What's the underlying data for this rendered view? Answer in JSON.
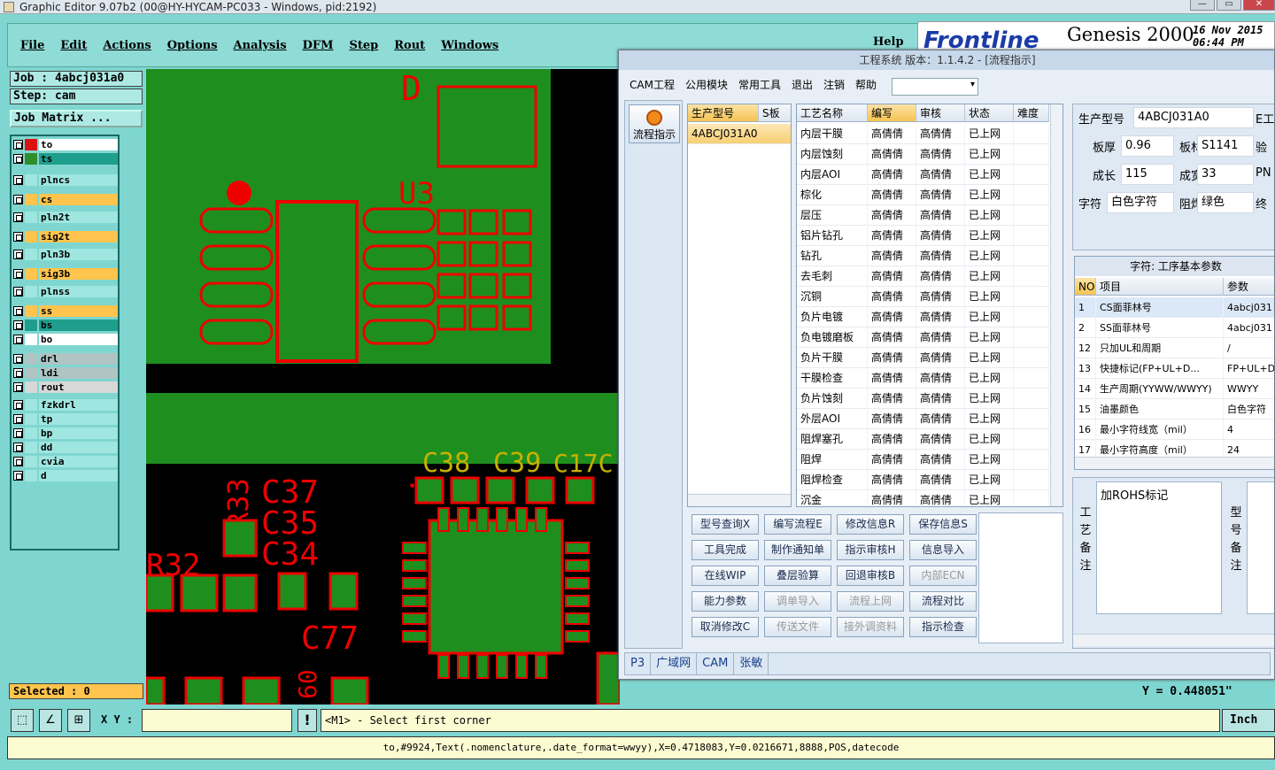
{
  "window": {
    "title": "Graphic Editor 9.07b2 (00@HY-HYCAM-PC033 - Windows, pid:2192)"
  },
  "menu": {
    "items": [
      "File",
      "Edit",
      "Actions",
      "Options",
      "Analysis",
      "DFM",
      "Step",
      "Rout",
      "Windows"
    ],
    "help": "Help"
  },
  "brand": {
    "logo": "Frontline",
    "product": "Genesis 2000",
    "date": "16 Nov 2015",
    "time": "06:44 PM"
  },
  "job": {
    "job_label": "Job : 4abcj031a0",
    "step_label": "Step: cam",
    "matrix_button": "Job Matrix ..."
  },
  "layers": [
    {
      "name": "to",
      "bg": "#ffffff",
      "swatch": "#d11"
    },
    {
      "name": "ts",
      "bg": "#1f9e8e",
      "swatch": "#2f8f2f"
    },
    {
      "name": "plncs",
      "bg": "#9fe6e0",
      "swatch": ""
    },
    {
      "name": "cs",
      "bg": "#ffc44d",
      "swatch": ""
    },
    {
      "name": "pln2t",
      "bg": "#9fe6e0",
      "swatch": ""
    },
    {
      "name": "sig2t",
      "bg": "#ffc44d",
      "swatch": ""
    },
    {
      "name": "pln3b",
      "bg": "#9fe6e0",
      "swatch": ""
    },
    {
      "name": "sig3b",
      "bg": "#ffc44d",
      "swatch": ""
    },
    {
      "name": "plnss",
      "bg": "#9fe6e0",
      "swatch": ""
    },
    {
      "name": "ss",
      "bg": "#ffc44d",
      "swatch": ""
    },
    {
      "name": "bs",
      "bg": "#1f9e8e",
      "swatch": ""
    },
    {
      "name": "bo",
      "bg": "#ffffff",
      "swatch": ""
    },
    {
      "name": "drl",
      "bg": "#b0c4c4",
      "swatch": ""
    },
    {
      "name": "ldi",
      "bg": "#b0c4c4",
      "swatch": ""
    },
    {
      "name": "rout",
      "bg": "#d8d8d8",
      "swatch": ""
    },
    {
      "name": "fzkdrl",
      "bg": "#9fe6e0",
      "swatch": ""
    },
    {
      "name": "tp",
      "bg": "#9fe6e0",
      "swatch": ""
    },
    {
      "name": "bp",
      "bg": "#9fe6e0",
      "swatch": ""
    },
    {
      "name": "dd",
      "bg": "#9fe6e0",
      "swatch": ""
    },
    {
      "name": "cvia",
      "bg": "#9fe6e0",
      "swatch": ""
    },
    {
      "name": "d",
      "bg": "#9fe6e0",
      "swatch": ""
    }
  ],
  "selected": "Selected : 0",
  "canvas_labels": {
    "u3": "U3",
    "d": "D",
    "c38": "C38",
    "c39": "C39",
    "c17": "C17C",
    "r33": "R33",
    "c37": "C37",
    "c35": "C35",
    "c34": "C34",
    "r32": "R32",
    "c77": "C77",
    "n60": "60"
  },
  "xy": {
    "label": "X Y :",
    "value": ""
  },
  "prompt": "<M1> - Select first corner",
  "units": "Inch",
  "y_readout": "Y = 0.448051\"",
  "status": "to,#9924,Text(.nomenclature,.date_format=wwyy),X=0.4718083,Y=0.0216671,8888,POS,datecode",
  "cam": {
    "title": "工程系统  版本：1.1.4.2 - [流程指示]",
    "menu": [
      "CAM工程",
      "公用模块",
      "常用工具",
      "退出",
      "注销",
      "帮助"
    ],
    "flow_button": "流程指示",
    "model_headers": [
      "生产型号",
      "S板"
    ],
    "model_row": "4ABCJ031A0",
    "proc_headers": [
      "工艺名称",
      "编写",
      "审核",
      "状态",
      "难度"
    ],
    "proc_rows": [
      [
        "内层干膜",
        "高倩倩",
        "高倩倩",
        "已上网"
      ],
      [
        "内层蚀刻",
        "高倩倩",
        "高倩倩",
        "已上网"
      ],
      [
        "内层AOI",
        "高倩倩",
        "高倩倩",
        "已上网"
      ],
      [
        "棕化",
        "高倩倩",
        "高倩倩",
        "已上网"
      ],
      [
        "层压",
        "高倩倩",
        "高倩倩",
        "已上网"
      ],
      [
        "铝片钻孔",
        "高倩倩",
        "高倩倩",
        "已上网"
      ],
      [
        "钻孔",
        "高倩倩",
        "高倩倩",
        "已上网"
      ],
      [
        "去毛刺",
        "高倩倩",
        "高倩倩",
        "已上网"
      ],
      [
        "沉铜",
        "高倩倩",
        "高倩倩",
        "已上网"
      ],
      [
        "负片电镀",
        "高倩倩",
        "高倩倩",
        "已上网"
      ],
      [
        "负电镀磨板",
        "高倩倩",
        "高倩倩",
        "已上网"
      ],
      [
        "负片干膜",
        "高倩倩",
        "高倩倩",
        "已上网"
      ],
      [
        "干膜检查",
        "高倩倩",
        "高倩倩",
        "已上网"
      ],
      [
        "负片蚀刻",
        "高倩倩",
        "高倩倩",
        "已上网"
      ],
      [
        "外层AOI",
        "高倩倩",
        "高倩倩",
        "已上网"
      ],
      [
        "阻焊塞孔",
        "高倩倩",
        "高倩倩",
        "已上网"
      ],
      [
        "阻焊",
        "高倩倩",
        "高倩倩",
        "已上网"
      ],
      [
        "阻焊检查",
        "高倩倩",
        "高倩倩",
        "已上网"
      ],
      [
        "沉金",
        "高倩倩",
        "高倩倩",
        "已上网"
      ]
    ],
    "buttons": [
      [
        "型号查询X",
        "编写流程E",
        "修改信息R",
        "保存信息S"
      ],
      [
        "工具完成",
        "制作通知单",
        "指示审核H",
        "信息导入"
      ],
      [
        "在线WIP",
        "叠层验算",
        "回退审核B",
        "内部ECN"
      ],
      [
        "能力参数",
        "调单导入",
        "流程上网",
        "流程对比"
      ],
      [
        "取消修改C",
        "传送文件",
        "接外调资料",
        "指示检查"
      ]
    ],
    "info": {
      "model_label": "生产型号",
      "model_value": "4ABCJ031A0",
      "extra": "E工",
      "thick_label": "板厚",
      "thick_value": "0.96",
      "mat_label": "板材",
      "mat_value": "S1141",
      "extra2": "验",
      "len_label": "成长",
      "len_value": "115",
      "wid_label": "成宽",
      "wid_value": "33",
      "extra3": "PN",
      "char_label": "字符",
      "char_value": "白色字符",
      "mask_label": "阻焊",
      "mask_value": "绿色",
      "extra4": "终"
    },
    "param_title": "字符: 工序基本参数",
    "param_headers": [
      "NO",
      "项目",
      "参数"
    ],
    "param_rows": [
      [
        "1",
        "CS面菲林号",
        "4abcj031"
      ],
      [
        "2",
        "SS面菲林号",
        "4abcj031"
      ],
      [
        "12",
        "只加UL和周期",
        "/"
      ],
      [
        "13",
        "快捷标记(FP+UL+D...",
        "FP+UL+DA"
      ],
      [
        "14",
        "生产周期(YYWW/WWYY)",
        "WWYY"
      ],
      [
        "15",
        "油墨颜色",
        "白色字符"
      ],
      [
        "16",
        "最小字符线宽（mil）",
        "4"
      ],
      [
        "17",
        "最小字符高度（mil）",
        "24"
      ]
    ],
    "remark_text": "加ROHS标记",
    "remark_label": "工艺备注",
    "remark_label2": "型号备注",
    "tabs": [
      "P3",
      "广域网",
      "CAM",
      "张敏"
    ]
  }
}
